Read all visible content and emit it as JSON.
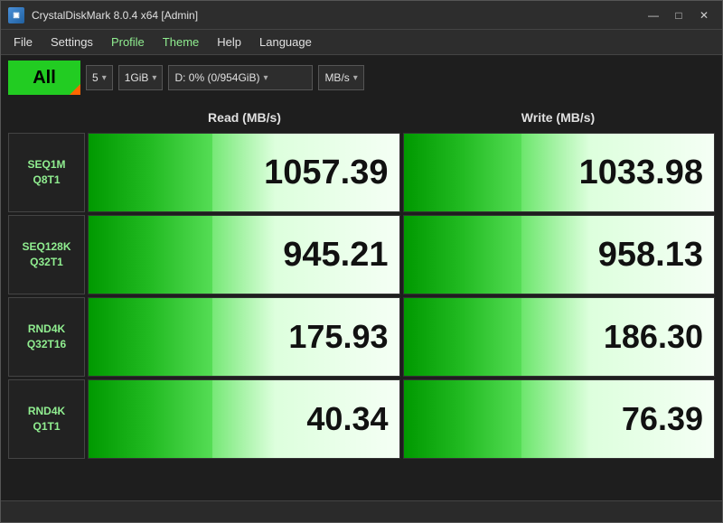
{
  "titleBar": {
    "title": "CrystalDiskMark 8.0.4 x64 [Admin]",
    "icon": "CDM",
    "controls": {
      "minimize": "—",
      "maximize": "□",
      "close": "✕"
    }
  },
  "menuBar": {
    "items": [
      {
        "id": "file",
        "label": "File",
        "highlighted": false
      },
      {
        "id": "settings",
        "label": "Settings",
        "highlighted": false
      },
      {
        "id": "profile",
        "label": "Profile",
        "highlighted": true
      },
      {
        "id": "theme",
        "label": "Theme",
        "highlighted": true
      },
      {
        "id": "help",
        "label": "Help",
        "highlighted": false
      },
      {
        "id": "language",
        "label": "Language",
        "highlighted": false
      }
    ]
  },
  "toolbar": {
    "allButton": "All",
    "countDropdown": {
      "value": "5",
      "arrow": "▾"
    },
    "sizeDropdown": {
      "value": "1GiB",
      "arrow": "▾"
    },
    "driveDropdown": {
      "value": "D: 0% (0/954GiB)",
      "arrow": "▾"
    },
    "unitDropdown": {
      "value": "MB/s",
      "arrow": "▾"
    }
  },
  "headers": {
    "read": "Read (MB/s)",
    "write": "Write (MB/s)"
  },
  "rows": [
    {
      "id": "seq1m-q8t1",
      "label1": "SEQ1M",
      "label2": "Q8T1",
      "read": "1057.39",
      "write": "1033.98"
    },
    {
      "id": "seq128k-q32t1",
      "label1": "SEQ128K",
      "label2": "Q32T1",
      "read": "945.21",
      "write": "958.13"
    },
    {
      "id": "rnd4k-q32t16",
      "label1": "RND4K",
      "label2": "Q32T16",
      "read": "175.93",
      "write": "186.30"
    },
    {
      "id": "rnd4k-q1t1",
      "label1": "RND4K",
      "label2": "Q1T1",
      "read": "40.34",
      "write": "76.39"
    }
  ],
  "colors": {
    "accent": "#22cc22",
    "background": "#1e1e1e",
    "menuBg": "#2d2d2d",
    "greenText": "#90EE90",
    "highlight": "#ff6600"
  }
}
